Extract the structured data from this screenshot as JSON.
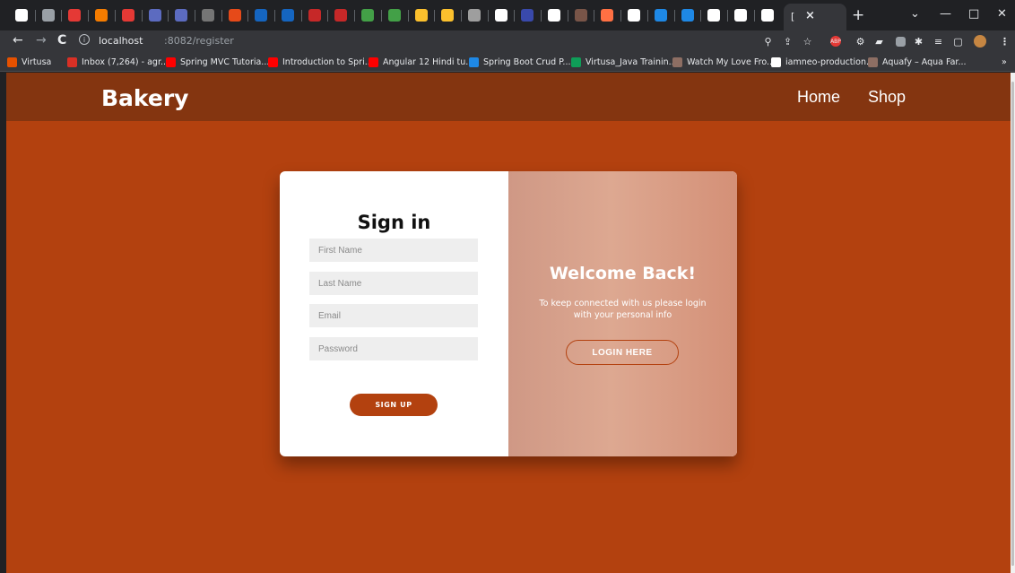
{
  "browser": {
    "tab_close": "×",
    "active_tab_partial": "[",
    "new_tab": "+",
    "url_host": "localhost",
    "url_path": ":8082/register",
    "controls": {
      "back": "←",
      "forward": "→",
      "reload": "C",
      "minimize": "—",
      "maximize": "□",
      "close": "✕",
      "tab_search": "⌄"
    },
    "tab_icon_colors": [
      "#ffffff",
      "#9aa0a6",
      "#e53935",
      "#f57c00",
      "#e53935",
      "#5c6bc0",
      "#5c6bc0",
      "#757575",
      "#e64a19",
      "#1565c0",
      "#1565c0",
      "#c62828",
      "#c62828",
      "#43a047",
      "#43a047",
      "#fbc02d",
      "#fbc02d",
      "#9e9e9e",
      "#ffffff",
      "#3949ab",
      "#ffffff",
      "#795548",
      "#ff7043",
      "#ffffff",
      "#1e88e5",
      "#1e88e5",
      "#ffffff",
      "#ffffff",
      "#ffffff"
    ]
  },
  "bookmarks": [
    {
      "label": "Virtusa",
      "color": "#e65100"
    },
    {
      "label": "Inbox (7,264) - agr...",
      "color": "#d93025"
    },
    {
      "label": "Spring MVC Tutoria...",
      "color": "#ff0000"
    },
    {
      "label": "Introduction to Spri...",
      "color": "#ff0000"
    },
    {
      "label": "Angular 12 Hindi tu...",
      "color": "#ff0000"
    },
    {
      "label": "Spring Boot Crud P...",
      "color": "#1e88e5"
    },
    {
      "label": "Virtusa_Java Trainin...",
      "color": "#0f9d58"
    },
    {
      "label": "Watch My Love Fro...",
      "color": "#8d6e63"
    },
    {
      "label": "iamneo-production...",
      "color": "#ffffff"
    },
    {
      "label": "Aquafy – Aqua Far...",
      "color": "#8d6e63"
    }
  ],
  "bookmarks_more": "»",
  "site": {
    "brand": "Bakery",
    "nav": {
      "home": "Home",
      "shop": "Shop"
    }
  },
  "signup_form": {
    "title": "Sign in",
    "first_name_placeholder": "First Name",
    "last_name_placeholder": "Last Name",
    "email_placeholder": "Email",
    "password_placeholder": "Password",
    "submit_label": "SIGN UP"
  },
  "overlay": {
    "title": "Welcome Back!",
    "text": "To keep connected with us please login with your personal info",
    "button_label": "LOGIN HERE"
  },
  "colors": {
    "page_bg": "#b3410f",
    "navbar_bg": "#843510",
    "accent": "#b3410f"
  }
}
